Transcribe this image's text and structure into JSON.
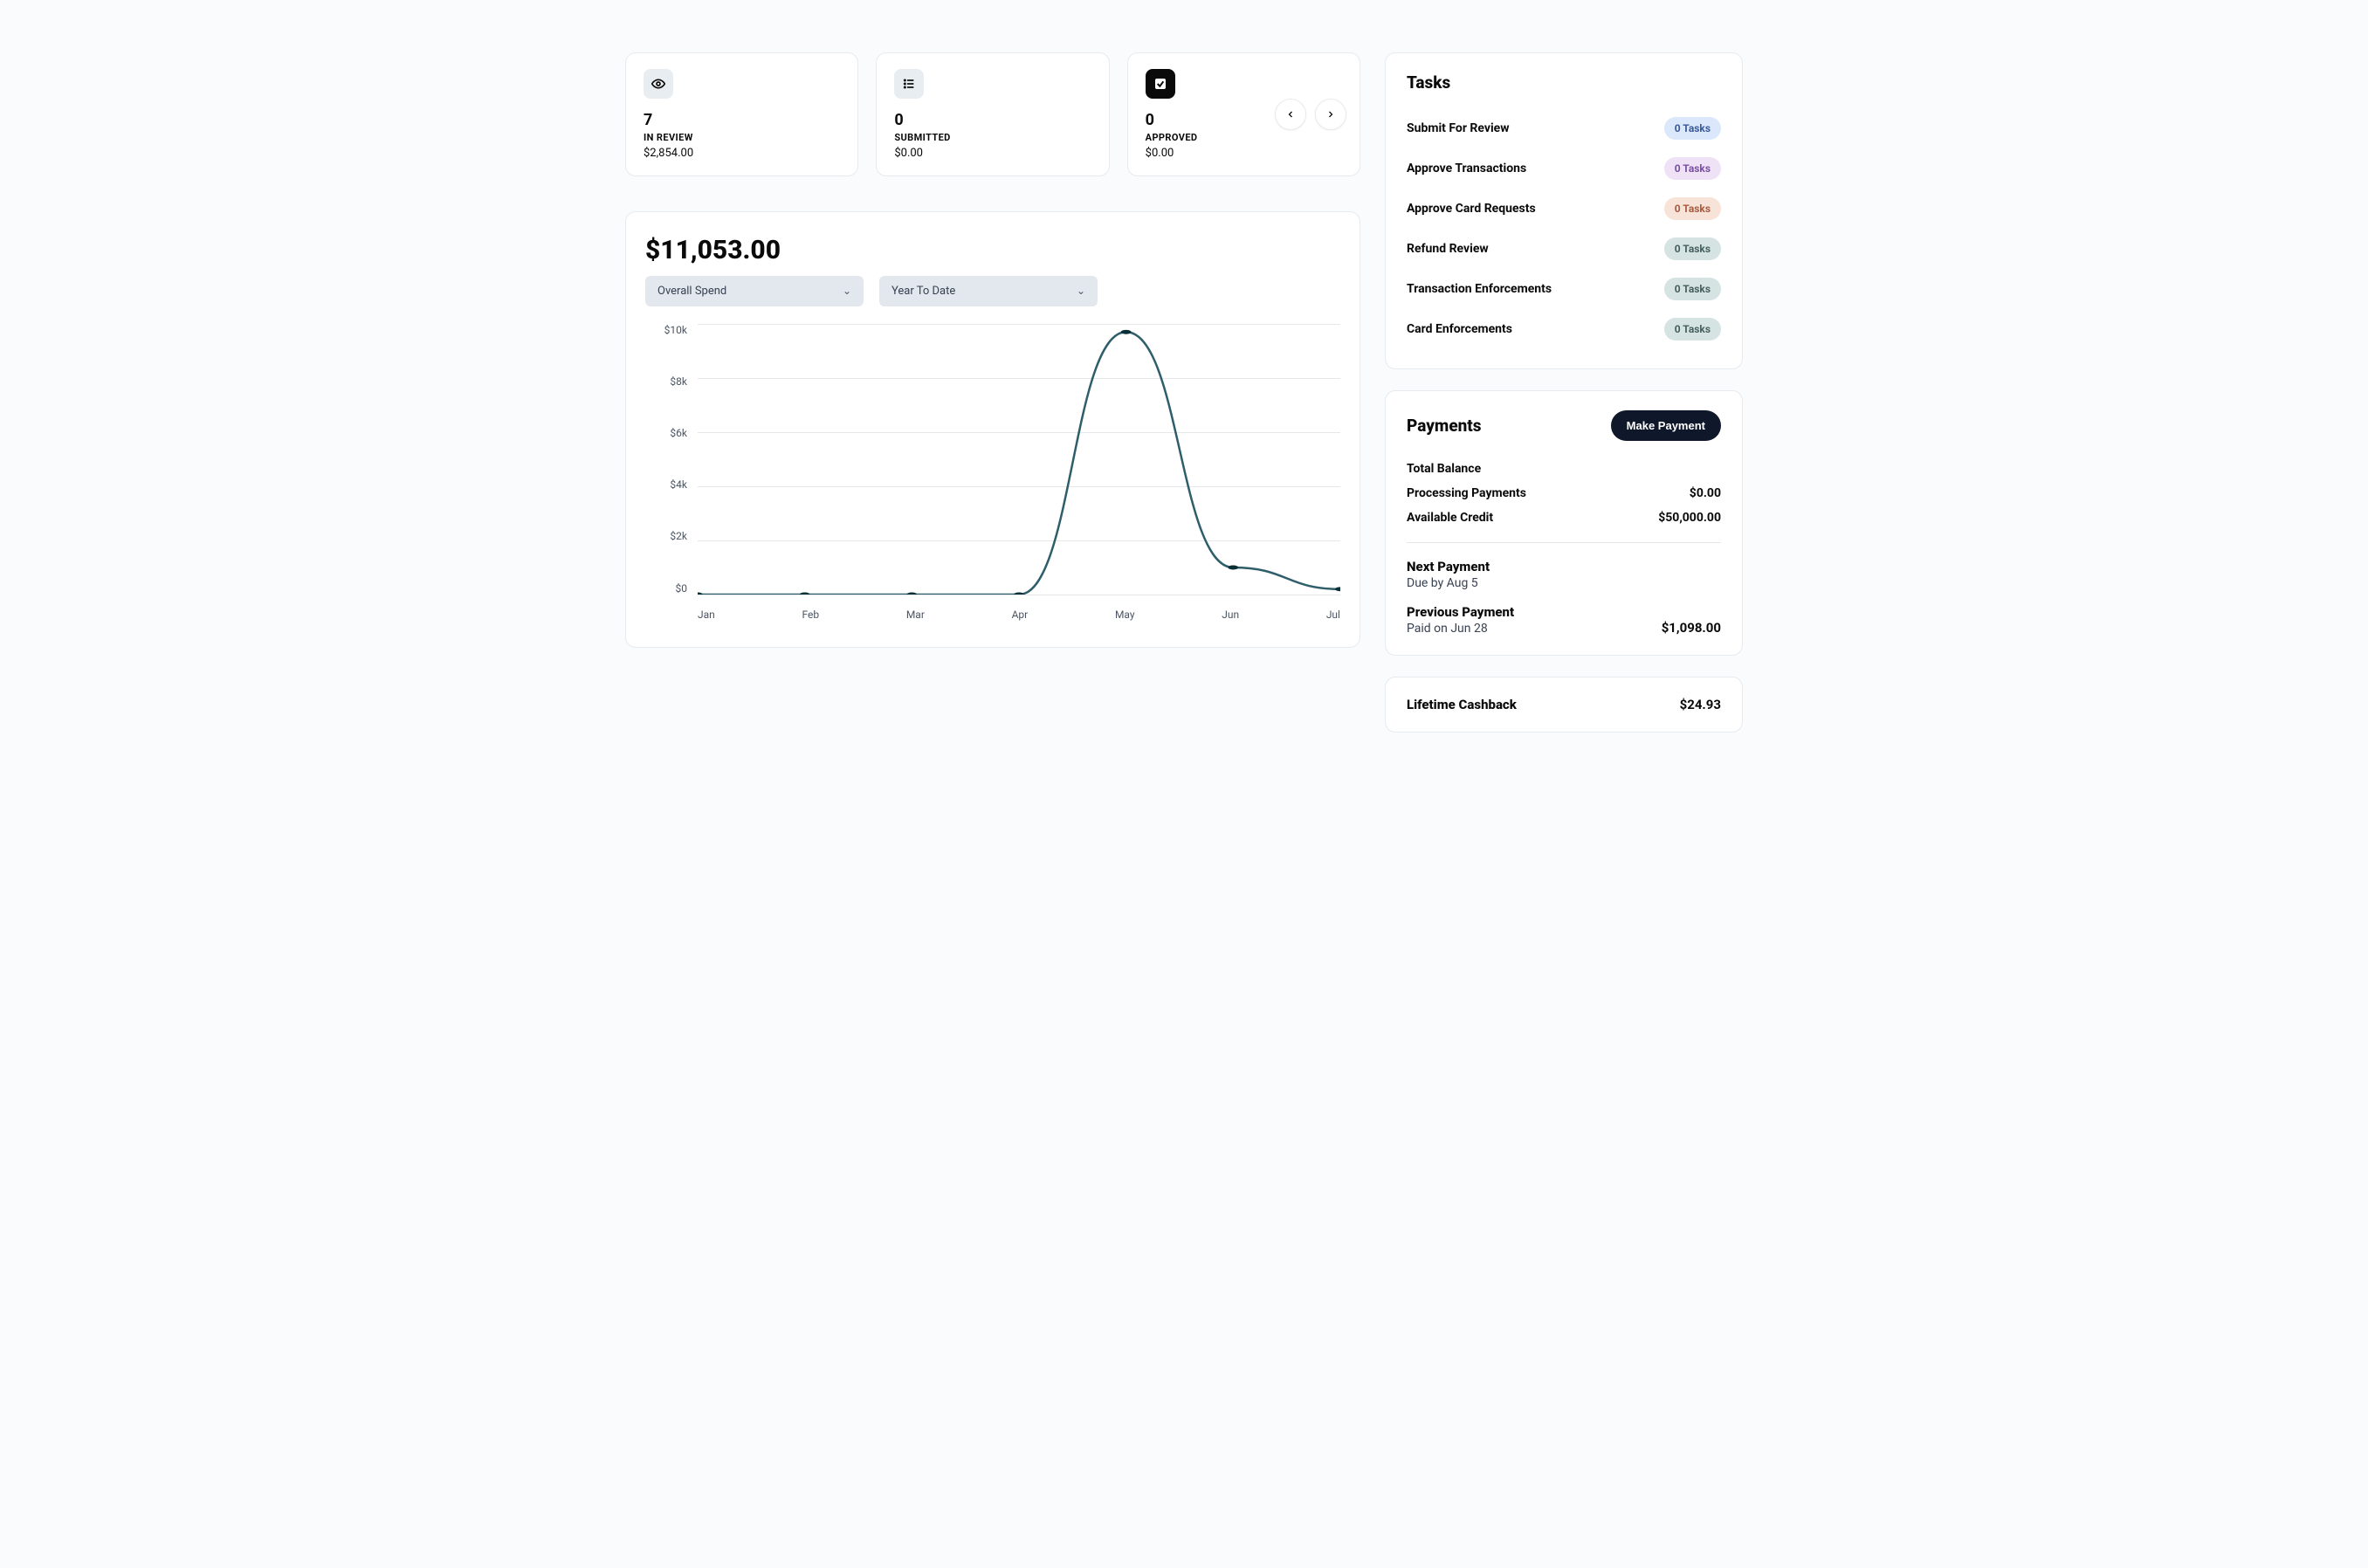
{
  "stats": [
    {
      "icon": "eye",
      "value": "7",
      "label": "IN REVIEW",
      "amount": "$2,854.00"
    },
    {
      "icon": "list",
      "value": "0",
      "label": "SUBMITTED",
      "amount": "$0.00"
    },
    {
      "icon": "check",
      "value": "0",
      "label": "APPROVED",
      "amount": "$0.00"
    }
  ],
  "chart": {
    "total": "$11,053.00",
    "select_metric": "Overall Spend",
    "select_range": "Year To Date"
  },
  "chart_data": {
    "type": "line",
    "title": "",
    "xlabel": "",
    "ylabel": "",
    "categories": [
      "Jan",
      "Feb",
      "Mar",
      "Apr",
      "May",
      "Jun",
      "Jul"
    ],
    "values": [
      0,
      0,
      0,
      0,
      9700,
      1000,
      200
    ],
    "yticks": [
      "$0",
      "$2k",
      "$4k",
      "$6k",
      "$8k",
      "$10k"
    ],
    "ylim": [
      0,
      10000
    ]
  },
  "tasks": {
    "title": "Tasks",
    "items": [
      {
        "name": "Submit For Review",
        "count": "0 Tasks",
        "bg": "#dbe7fb",
        "fg": "#3b5a9a"
      },
      {
        "name": "Approve Transactions",
        "count": "0 Tasks",
        "bg": "#efe2f7",
        "fg": "#7a4fa3"
      },
      {
        "name": "Approve Card Requests",
        "count": "0 Tasks",
        "bg": "#f8e3d9",
        "fg": "#a65b3e"
      },
      {
        "name": "Refund Review",
        "count": "0 Tasks",
        "bg": "#d6e3e3",
        "fg": "#45605f"
      },
      {
        "name": "Transaction Enforcements",
        "count": "0 Tasks",
        "bg": "#d6e3e3",
        "fg": "#45605f"
      },
      {
        "name": "Card Enforcements",
        "count": "0 Tasks",
        "bg": "#d6e3e3",
        "fg": "#45605f"
      }
    ]
  },
  "payments": {
    "title": "Payments",
    "button": "Make Payment",
    "lines": {
      "total_balance_label": "Total Balance",
      "processing_label": "Processing Payments",
      "processing_value": "$0.00",
      "credit_label": "Available Credit",
      "credit_value": "$50,000.00"
    },
    "next": {
      "label": "Next Payment",
      "sub": "Due by Aug 5",
      "value": ""
    },
    "prev": {
      "label": "Previous Payment",
      "sub": "Paid on Jun 28",
      "value": "$1,098.00"
    }
  },
  "cashback": {
    "label": "Lifetime Cashback",
    "value": "$24.93"
  }
}
